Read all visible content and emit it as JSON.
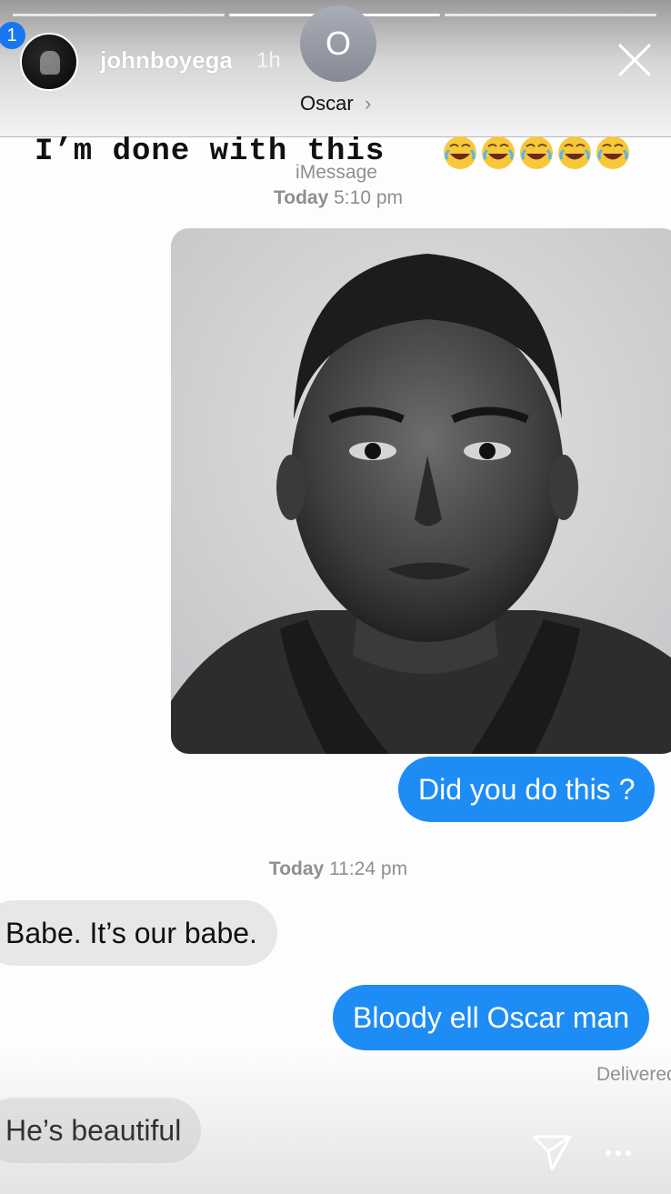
{
  "story": {
    "progress_segments": 3,
    "active_segment": 1,
    "notification_badge": "1",
    "username": "johnboyega",
    "time_ago": "1h",
    "caption": "I’m done with this"
  },
  "imessage": {
    "contact_initial": "O",
    "contact_name": "Oscar",
    "contact_chevron": "›",
    "service_label": "iMessage",
    "timestamp_1_day": "Today",
    "timestamp_1_time": "5:10 pm",
    "timestamp_2_day": "Today",
    "timestamp_2_time": "11:24 pm",
    "delivered_label": "Delivered"
  },
  "messages": [
    {
      "type": "out",
      "text": "Did you do this ?"
    },
    {
      "type": "in",
      "text": "Babe. It’s our babe."
    },
    {
      "type": "out",
      "text": "Bloody ell Oscar man"
    },
    {
      "type": "in",
      "text": "He’s beautiful"
    }
  ],
  "icons": {
    "close": "close-icon",
    "send": "send-icon",
    "more": "more-icon",
    "emoji": "face-with-tears-of-joy-icon"
  },
  "colors": {
    "sent_bubble": "#1e8cf5",
    "received_bubble": "#e7e7ea",
    "badge": "#1976f2"
  }
}
